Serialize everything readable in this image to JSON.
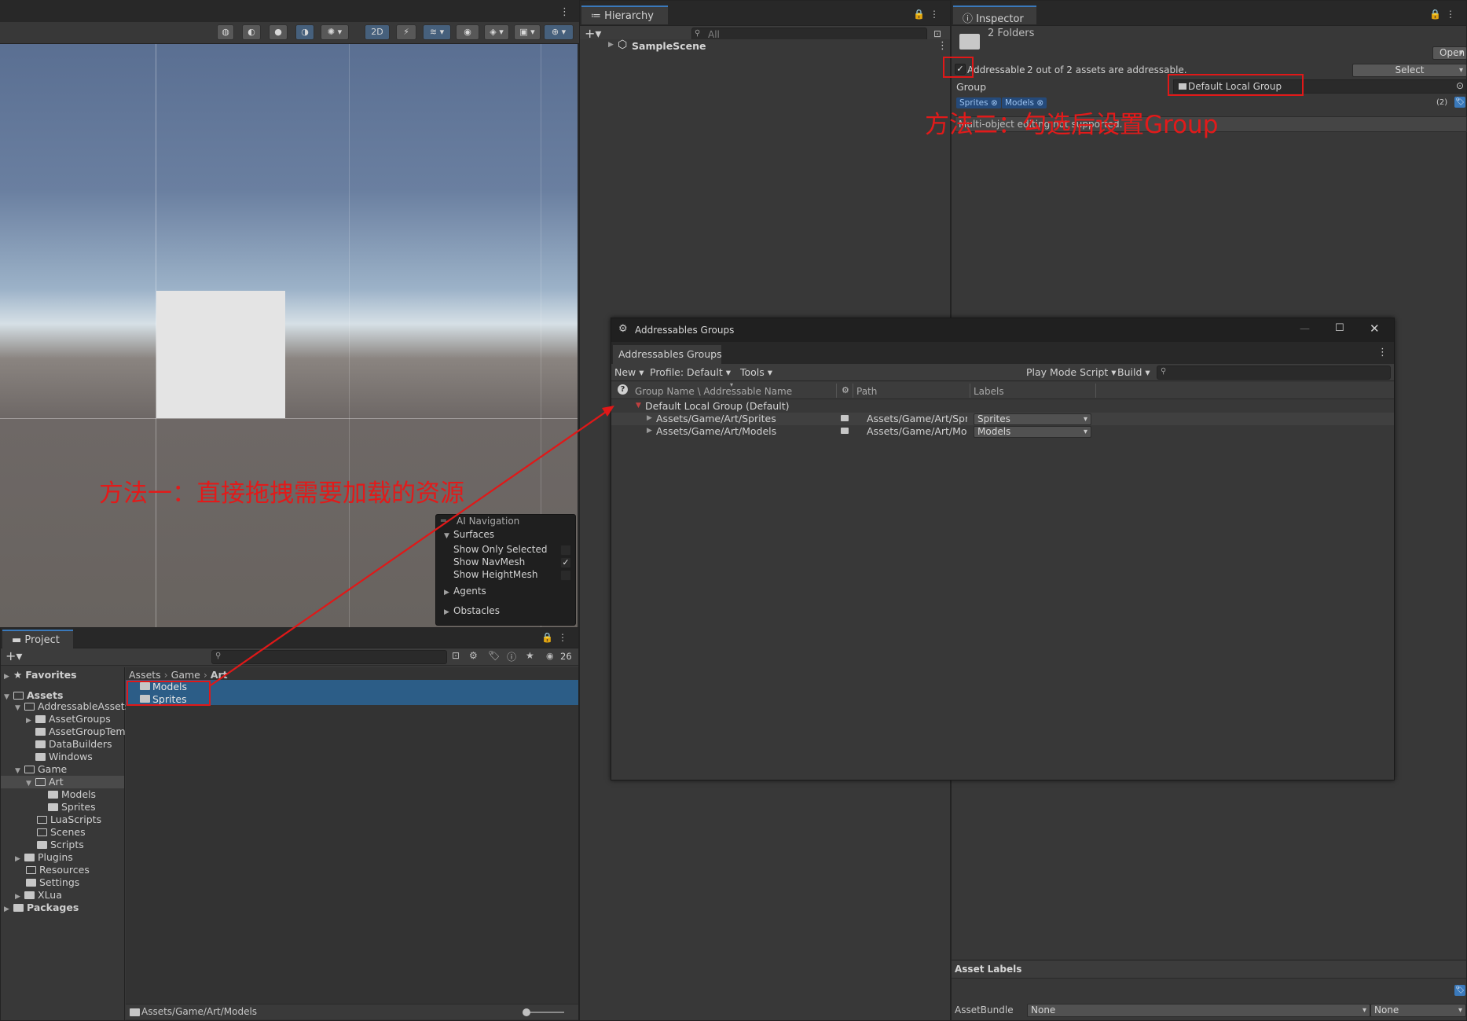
{
  "scene": {
    "toolbar": {
      "mode_2d": "2D"
    },
    "ai_nav": {
      "title": "AI Navigation",
      "surfaces": "Surfaces",
      "opt1": "Show Only Selected",
      "opt2": "Show NavMesh",
      "opt3": "Show HeightMesh",
      "agents": "Agents",
      "obstacles": "Obstacles"
    },
    "annotation": "方法一：直接拖拽需要加载的资源"
  },
  "hierarchy": {
    "tab": "Hierarchy",
    "search_placeholder": "All",
    "scene_name": "SampleScene"
  },
  "inspector": {
    "tab": "Inspector",
    "title": "2 Folders",
    "open_button": "Open",
    "addressable_label": "Addressable",
    "addressable_status": "2 out of 2 assets are addressable.",
    "select_button": "Select",
    "group_label": "Group",
    "group_value": "Default Local Group",
    "labels": [
      "Sprites",
      "Models"
    ],
    "label_count": "(2)",
    "multi_edit": "Multi-object editing not supported.",
    "annotation": "方法二：勾选后设置Group",
    "asset_labels": "Asset Labels",
    "assetbundle_label": "AssetBundle",
    "assetbundle_value": "None",
    "assetbundle_variant": "None"
  },
  "addressables": {
    "window_title": "Addressables Groups",
    "tab": "Addressables Groups",
    "menu": {
      "new": "New",
      "profile": "Profile: Default",
      "tools": "Tools",
      "play_mode": "Play Mode Script",
      "build": "Build"
    },
    "columns": {
      "name": "Group Name \\ Addressable Name",
      "path": "Path",
      "labels": "Labels"
    },
    "group": "Default Local Group (Default)",
    "entries": [
      {
        "name": "Assets/Game/Art/Sprites",
        "path": "Assets/Game/Art/Sprit",
        "label": "Sprites"
      },
      {
        "name": "Assets/Game/Art/Models",
        "path": "Assets/Game/Art/Mode",
        "label": "Models"
      }
    ]
  },
  "project": {
    "tab": "Project",
    "count": "26",
    "tree": {
      "favorites": "Favorites",
      "assets": "Assets",
      "addressable_assets": "AddressableAssets",
      "asset_groups": "AssetGroups",
      "asset_group_templates": "AssetGroupTem",
      "data_builders": "DataBuilders",
      "windows": "Windows",
      "game": "Game",
      "art": "Art",
      "models": "Models",
      "sprites": "Sprites",
      "lua_scripts": "LuaScripts",
      "scenes": "Scenes",
      "scripts": "Scripts",
      "plugins": "Plugins",
      "resources": "Resources",
      "settings": "Settings",
      "xlua": "XLua",
      "packages": "Packages"
    },
    "breadcrumb": [
      "Assets",
      "Game",
      "Art"
    ],
    "items": [
      "Models",
      "Sprites"
    ],
    "status_path": "Assets/Game/Art/Models"
  }
}
